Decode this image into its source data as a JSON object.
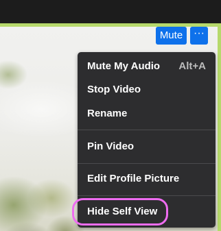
{
  "toolbar": {
    "mute_label": "Mute",
    "more_label": "···"
  },
  "menu": {
    "items": [
      {
        "label": "Mute My Audio",
        "shortcut": "Alt+A"
      },
      {
        "label": "Stop Video"
      },
      {
        "label": "Rename"
      },
      {
        "label": "Pin Video"
      },
      {
        "label": "Edit Profile Picture"
      },
      {
        "label": "Hide Self View"
      }
    ]
  },
  "colors": {
    "accent": "#0e71eb",
    "menu_bg": "#2d2d2f",
    "active_speaker_border": "#b6d96b",
    "annotation": "#ee6cf0"
  },
  "icons": {
    "more": "more-horizontal-icon"
  }
}
